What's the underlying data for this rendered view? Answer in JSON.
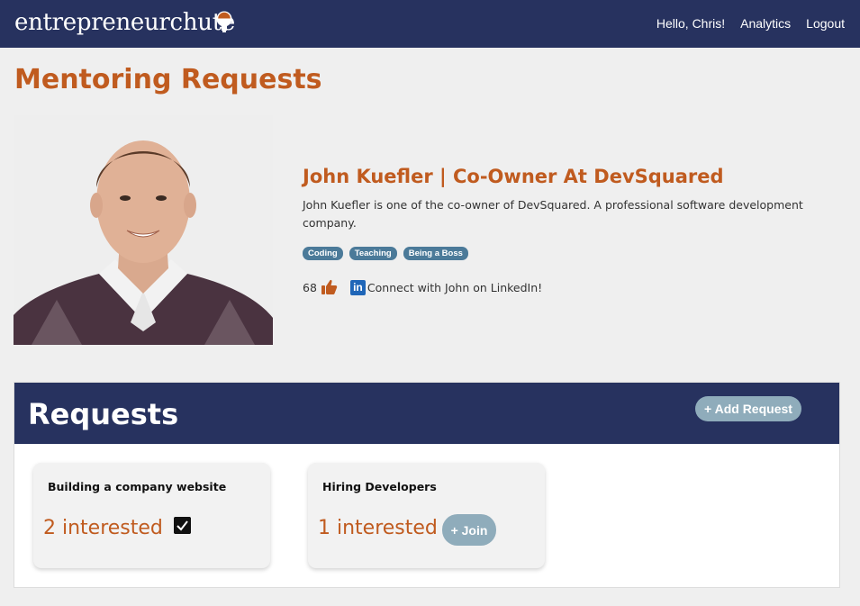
{
  "nav": {
    "brand": "entrepreneurchute",
    "greeting": "Hello, Chris!",
    "analytics": "Analytics",
    "logout": "Logout"
  },
  "page": {
    "title": "Mentoring Requests"
  },
  "profile": {
    "name": "John Kuefler | Co-Owner At DevSquared",
    "description": "John Kuefler is one of the co-owner of DevSquared. A professional software development company.",
    "tags": [
      "Coding",
      "Teaching",
      "Being a Boss"
    ],
    "likes": "68",
    "linkedin_icon_text": "in",
    "linkedin_label": "Connect with John on LinkedIn!"
  },
  "requests": {
    "title": "Requests",
    "add_label": "+ Add Request",
    "items": [
      {
        "title": "Building a company website",
        "interest": "2 interested",
        "joined": true
      },
      {
        "title": "Hiring Developers",
        "interest": "1 interested",
        "joined": false,
        "join_label": "+ Join"
      }
    ]
  },
  "colors": {
    "nav_bg": "#27325f",
    "accent": "#c05b1f",
    "tag_bg": "#4b7a99",
    "button_bg": "#8facbb",
    "linkedin": "#1f66b8"
  }
}
